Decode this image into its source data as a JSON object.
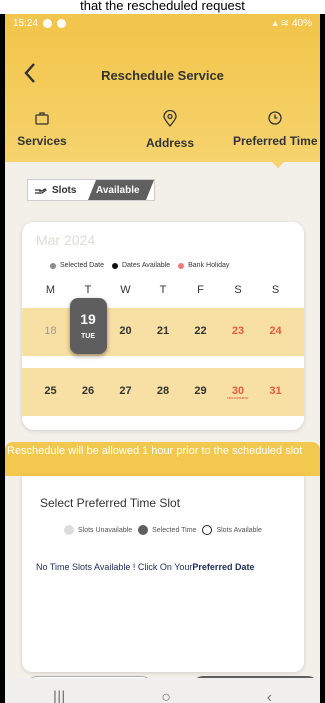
{
  "caption": "that the rescheduled request",
  "status": {
    "time": "15:24",
    "battery": "40%"
  },
  "header": {
    "title": "Reschedule Service",
    "back_icon": "chevron-left-icon"
  },
  "steps": [
    {
      "label": "Services",
      "icon": "briefcase-icon"
    },
    {
      "label": "Address",
      "icon": "location-pin-icon"
    },
    {
      "label": "Preferred Time",
      "icon": "clock-icon"
    }
  ],
  "slots_toggle": {
    "label": "Slots",
    "value": "Available"
  },
  "calendar": {
    "month": "Mar 2024",
    "legend": [
      {
        "label": "Selected Date",
        "color": "#8a8a8a"
      },
      {
        "label": "Dates Available",
        "color": "#111111"
      },
      {
        "label": "Bank Holiday",
        "color": "#f07a78"
      }
    ],
    "weekdays": [
      "M",
      "T",
      "W",
      "T",
      "F",
      "S",
      "S"
    ],
    "week1": [
      "18",
      "19",
      "20",
      "21",
      "22",
      "23",
      "24"
    ],
    "week2": [
      "25",
      "26",
      "27",
      "28",
      "29",
      "30",
      "31"
    ],
    "selected_day": "TUE",
    "holiday_note": "HOLI HOLIDAY"
  },
  "notice": "Reschedule will be allowed 1 hour prior to the scheduled slot",
  "time_slot": {
    "title": "Select Preferred Time Slot",
    "legend": [
      {
        "label": "Slots Unavailable",
        "color": "#dddddd"
      },
      {
        "label": "Selected Time",
        "color": "#5e5e5e"
      },
      {
        "label": "Slots Available",
        "color": "#ffffff"
      }
    ],
    "message": "No Time Slots Available ! Click On Your",
    "message_link": "Preferred Date"
  },
  "navbar": {
    "recents": "|||",
    "home": "○",
    "back": "‹"
  },
  "colors": {
    "accent": "#f2c64c",
    "week_bg": "#f8e0a5",
    "holiday": "#e85a3c"
  }
}
